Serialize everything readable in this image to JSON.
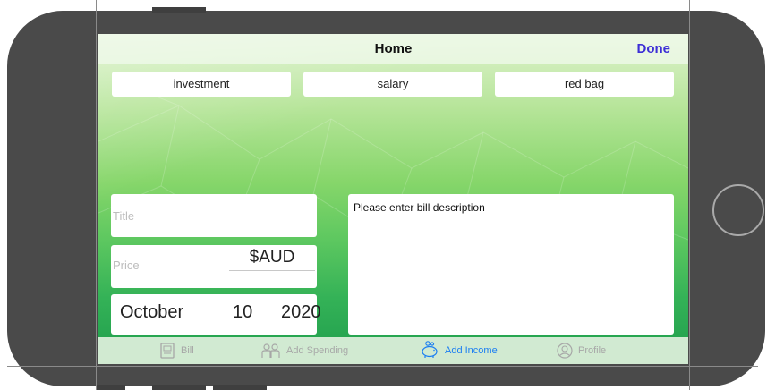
{
  "nav": {
    "title": "Home",
    "done_label": "Done"
  },
  "categories": [
    "investment",
    "salary",
    "red bag"
  ],
  "form": {
    "title_placeholder": "Title",
    "price_placeholder": "Price",
    "currency": "$AUD",
    "date": {
      "month": "October",
      "day": "10",
      "year": "2020"
    },
    "description_placeholder": "Please enter bill description"
  },
  "tabs": [
    {
      "label": "Bill",
      "icon": "bill-icon",
      "active": false
    },
    {
      "label": "Add Spending",
      "icon": "add-spending-icon",
      "active": false
    },
    {
      "label": "Add Income",
      "icon": "piggy-bank-icon",
      "active": true
    },
    {
      "label": "Profile",
      "icon": "profile-icon",
      "active": false
    }
  ],
  "colors": {
    "accent": "#1b7ef2",
    "done": "#3d2fd6",
    "tab_inactive": "#a7a7a7"
  }
}
